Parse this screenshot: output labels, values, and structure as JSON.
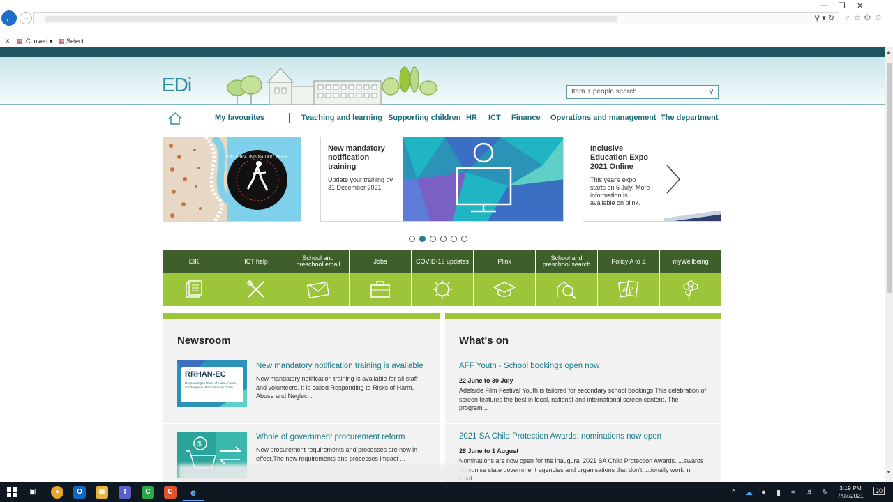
{
  "browser": {
    "cmd_convert": "Convert",
    "cmd_select": "Select",
    "close_tab_glyph": "×"
  },
  "site": {
    "logo": "EDi",
    "search_placeholder": "Item + people search",
    "nav": [
      "My favourites",
      "Teaching and learning",
      "Supporting children",
      "HR",
      "ICT",
      "Finance",
      "Operations and management",
      "The department"
    ],
    "carousel": {
      "card2_title": "New mandatory notification training",
      "card2_body": "Update your training by 31 December 2021.",
      "card3_title": "Inclusive Education Expo 2021 Online",
      "card3_body": "This year's expo starts on 5 July. More information is available on plink.",
      "naidoc_text": "CELEBRATING NAIDOC WEEK",
      "slides_total": 6,
      "active_slide": 2
    },
    "tiles": [
      {
        "label": "EIK",
        "icon": "documents-icon"
      },
      {
        "label": "ICT help",
        "icon": "tools-icon"
      },
      {
        "label": "School and preschool email",
        "icon": "envelope-icon"
      },
      {
        "label": "Jobs",
        "icon": "briefcase-icon"
      },
      {
        "label": "COVID-19 updates",
        "icon": "virus-icon"
      },
      {
        "label": "Plink",
        "icon": "graduation-cap-icon"
      },
      {
        "label": "School and preschool search",
        "icon": "magnifier-icon"
      },
      {
        "label": "Policy A to Z",
        "icon": "az-icon"
      },
      {
        "label": "myWellbeing",
        "icon": "flower-icon"
      }
    ],
    "newsroom": {
      "heading": "Newsroom",
      "items": [
        {
          "title": "New mandatory notification training is available",
          "body": "New mandatory notification training is available for all staff and volunteers. It is called Responding to Risks of Harm, Abuse and Neglec...",
          "thumb_title": "RRHAN-EC",
          "thumb_sub": "Responding to Risks of Harm, Abuse and Neglect – Education and Care"
        },
        {
          "title": "Whole of government procurement reform",
          "body": "New procurement requirements and processes are now in effect.The new requirements and processes impact ..."
        }
      ]
    },
    "whatson": {
      "heading": "What's on",
      "items": [
        {
          "title": "AFF Youth - School bookings open now",
          "date": "22 June to 30 July",
          "body": "Adelaide Film Festival Youth is tailored for secondary school bookings This celebration of screen features the best in local, national and international screen content. The program..."
        },
        {
          "title": "2021 SA Child Protection Awards: nominations now open",
          "date": "28 June to 1 August",
          "body": "Nominations are now open for the inaugural 2021 SA Child Protection Awards. ...awards recognise state government agencies and organisations that don't ...tionally work in child..."
        }
      ]
    }
  },
  "taskbar": {
    "time": "3:19 PM",
    "date": "7/07/2021",
    "notifications": "20"
  },
  "colors": {
    "brand_teal": "#1b6c78",
    "tile_dark": "#3e5e2b",
    "tile_light": "#9cc53a"
  }
}
